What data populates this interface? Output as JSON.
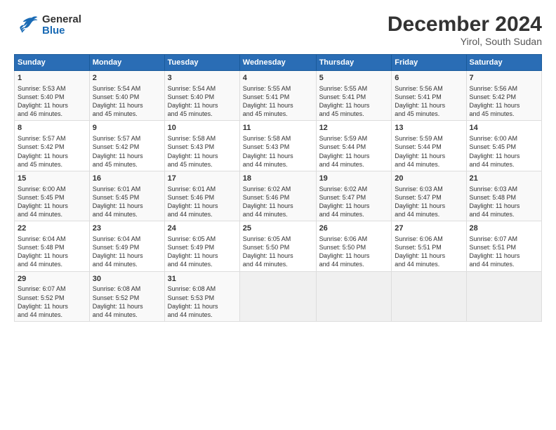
{
  "header": {
    "logo_general": "General",
    "logo_blue": "Blue",
    "month_title": "December 2024",
    "location": "Yirol, South Sudan"
  },
  "days_of_week": [
    "Sunday",
    "Monday",
    "Tuesday",
    "Wednesday",
    "Thursday",
    "Friday",
    "Saturday"
  ],
  "weeks": [
    [
      {
        "day": "1",
        "data": "Sunrise: 5:53 AM\nSunset: 5:40 PM\nDaylight: 11 hours\nand 46 minutes."
      },
      {
        "day": "2",
        "data": "Sunrise: 5:54 AM\nSunset: 5:40 PM\nDaylight: 11 hours\nand 45 minutes."
      },
      {
        "day": "3",
        "data": "Sunrise: 5:54 AM\nSunset: 5:40 PM\nDaylight: 11 hours\nand 45 minutes."
      },
      {
        "day": "4",
        "data": "Sunrise: 5:55 AM\nSunset: 5:41 PM\nDaylight: 11 hours\nand 45 minutes."
      },
      {
        "day": "5",
        "data": "Sunrise: 5:55 AM\nSunset: 5:41 PM\nDaylight: 11 hours\nand 45 minutes."
      },
      {
        "day": "6",
        "data": "Sunrise: 5:56 AM\nSunset: 5:41 PM\nDaylight: 11 hours\nand 45 minutes."
      },
      {
        "day": "7",
        "data": "Sunrise: 5:56 AM\nSunset: 5:42 PM\nDaylight: 11 hours\nand 45 minutes."
      }
    ],
    [
      {
        "day": "8",
        "data": "Sunrise: 5:57 AM\nSunset: 5:42 PM\nDaylight: 11 hours\nand 45 minutes."
      },
      {
        "day": "9",
        "data": "Sunrise: 5:57 AM\nSunset: 5:42 PM\nDaylight: 11 hours\nand 45 minutes."
      },
      {
        "day": "10",
        "data": "Sunrise: 5:58 AM\nSunset: 5:43 PM\nDaylight: 11 hours\nand 45 minutes."
      },
      {
        "day": "11",
        "data": "Sunrise: 5:58 AM\nSunset: 5:43 PM\nDaylight: 11 hours\nand 44 minutes."
      },
      {
        "day": "12",
        "data": "Sunrise: 5:59 AM\nSunset: 5:44 PM\nDaylight: 11 hours\nand 44 minutes."
      },
      {
        "day": "13",
        "data": "Sunrise: 5:59 AM\nSunset: 5:44 PM\nDaylight: 11 hours\nand 44 minutes."
      },
      {
        "day": "14",
        "data": "Sunrise: 6:00 AM\nSunset: 5:45 PM\nDaylight: 11 hours\nand 44 minutes."
      }
    ],
    [
      {
        "day": "15",
        "data": "Sunrise: 6:00 AM\nSunset: 5:45 PM\nDaylight: 11 hours\nand 44 minutes."
      },
      {
        "day": "16",
        "data": "Sunrise: 6:01 AM\nSunset: 5:45 PM\nDaylight: 11 hours\nand 44 minutes."
      },
      {
        "day": "17",
        "data": "Sunrise: 6:01 AM\nSunset: 5:46 PM\nDaylight: 11 hours\nand 44 minutes."
      },
      {
        "day": "18",
        "data": "Sunrise: 6:02 AM\nSunset: 5:46 PM\nDaylight: 11 hours\nand 44 minutes."
      },
      {
        "day": "19",
        "data": "Sunrise: 6:02 AM\nSunset: 5:47 PM\nDaylight: 11 hours\nand 44 minutes."
      },
      {
        "day": "20",
        "data": "Sunrise: 6:03 AM\nSunset: 5:47 PM\nDaylight: 11 hours\nand 44 minutes."
      },
      {
        "day": "21",
        "data": "Sunrise: 6:03 AM\nSunset: 5:48 PM\nDaylight: 11 hours\nand 44 minutes."
      }
    ],
    [
      {
        "day": "22",
        "data": "Sunrise: 6:04 AM\nSunset: 5:48 PM\nDaylight: 11 hours\nand 44 minutes."
      },
      {
        "day": "23",
        "data": "Sunrise: 6:04 AM\nSunset: 5:49 PM\nDaylight: 11 hours\nand 44 minutes."
      },
      {
        "day": "24",
        "data": "Sunrise: 6:05 AM\nSunset: 5:49 PM\nDaylight: 11 hours\nand 44 minutes."
      },
      {
        "day": "25",
        "data": "Sunrise: 6:05 AM\nSunset: 5:50 PM\nDaylight: 11 hours\nand 44 minutes."
      },
      {
        "day": "26",
        "data": "Sunrise: 6:06 AM\nSunset: 5:50 PM\nDaylight: 11 hours\nand 44 minutes."
      },
      {
        "day": "27",
        "data": "Sunrise: 6:06 AM\nSunset: 5:51 PM\nDaylight: 11 hours\nand 44 minutes."
      },
      {
        "day": "28",
        "data": "Sunrise: 6:07 AM\nSunset: 5:51 PM\nDaylight: 11 hours\nand 44 minutes."
      }
    ],
    [
      {
        "day": "29",
        "data": "Sunrise: 6:07 AM\nSunset: 5:52 PM\nDaylight: 11 hours\nand 44 minutes."
      },
      {
        "day": "30",
        "data": "Sunrise: 6:08 AM\nSunset: 5:52 PM\nDaylight: 11 hours\nand 44 minutes."
      },
      {
        "day": "31",
        "data": "Sunrise: 6:08 AM\nSunset: 5:53 PM\nDaylight: 11 hours\nand 44 minutes."
      },
      {
        "day": "",
        "data": ""
      },
      {
        "day": "",
        "data": ""
      },
      {
        "day": "",
        "data": ""
      },
      {
        "day": "",
        "data": ""
      }
    ]
  ]
}
